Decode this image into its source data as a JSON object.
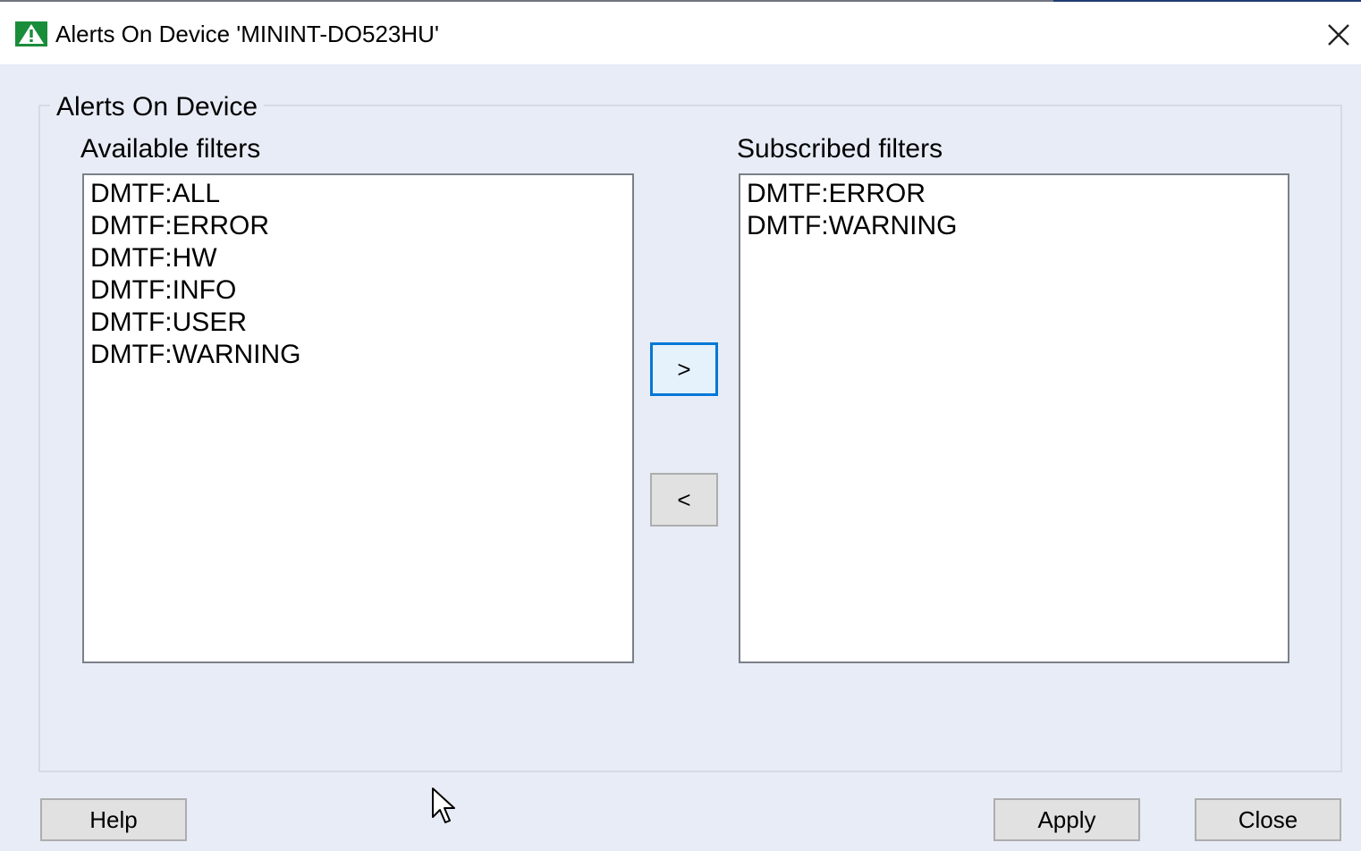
{
  "window": {
    "title": "Alerts On Device 'MININT-DO523HU'",
    "app_icon": "warning-triangle-icon",
    "close_icon": "close-icon"
  },
  "group": {
    "legend": "Alerts On Device"
  },
  "available": {
    "label": "Available filters",
    "items": [
      "DMTF:ALL",
      "DMTF:ERROR",
      "DMTF:HW",
      "DMTF:INFO",
      "DMTF:USER",
      "DMTF:WARNING"
    ]
  },
  "subscribed": {
    "label": "Subscribed filters",
    "items": [
      "DMTF:ERROR",
      "DMTF:WARNING"
    ]
  },
  "transfer": {
    "add_label": ">",
    "remove_label": "<"
  },
  "footer": {
    "help_label": "Help",
    "apply_label": "Apply",
    "close_label": "Close"
  },
  "colors": {
    "focus_accent": "#0078d7",
    "icon_green": "#1a8d3a",
    "dialog_background": "#e8ecf6"
  }
}
